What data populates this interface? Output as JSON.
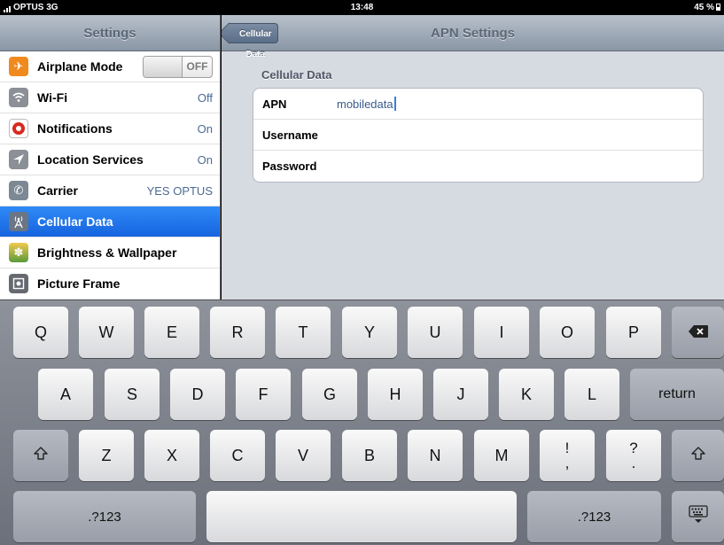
{
  "status_bar": {
    "carrier": "OPTUS",
    "network": "3G",
    "time": "13:48",
    "battery": "45 %"
  },
  "master": {
    "title": "Settings",
    "items": [
      {
        "label": "Airplane Mode",
        "icon": "airplane-icon",
        "icon_color": "#f08a1c",
        "toggle": "OFF"
      },
      {
        "label": "Wi-Fi",
        "icon": "wifi-icon",
        "icon_color": "#8b8f96",
        "value": "Off"
      },
      {
        "label": "Notifications",
        "icon": "notifications-icon",
        "icon_color": "#d92a1f",
        "value": "On"
      },
      {
        "label": "Location Services",
        "icon": "location-icon",
        "icon_color": "#8b8f96",
        "value": "On"
      },
      {
        "label": "Carrier",
        "icon": "phone-icon",
        "icon_color": "#7c8894",
        "value": "YES OPTUS"
      },
      {
        "label": "Cellular Data",
        "icon": "cellular-antenna-icon",
        "icon_color": "#6b7584",
        "selected": true
      },
      {
        "label": "Brightness & Wallpaper",
        "icon": "brightness-wallpaper-icon",
        "icon_color": "#5a9a3c"
      },
      {
        "label": "Picture Frame",
        "icon": "picture-frame-icon",
        "icon_color": "#666a70"
      }
    ]
  },
  "detail": {
    "back_label": "Cellular Data",
    "title": "APN Settings",
    "section_header": "Cellular Data",
    "rows": [
      {
        "label": "APN",
        "value": "mobiledata"
      },
      {
        "label": "Username",
        "value": ""
      },
      {
        "label": "Password",
        "value": ""
      }
    ]
  },
  "keyboard": {
    "row1": [
      "Q",
      "W",
      "E",
      "R",
      "T",
      "Y",
      "U",
      "I",
      "O",
      "P"
    ],
    "backspace_icon": "backspace-icon",
    "row2": [
      "A",
      "S",
      "D",
      "F",
      "G",
      "H",
      "J",
      "K",
      "L"
    ],
    "return_label": "return",
    "shift_icon": "shift-icon",
    "row3": [
      "Z",
      "X",
      "C",
      "V",
      "B",
      "N",
      "M"
    ],
    "punct1": {
      "top": "!",
      "bottom": ","
    },
    "punct2": {
      "top": "?",
      "bottom": "."
    },
    "numbers_label": ".?123",
    "space_label": "",
    "hide_keyboard_icon": "hide-keyboard-icon"
  }
}
